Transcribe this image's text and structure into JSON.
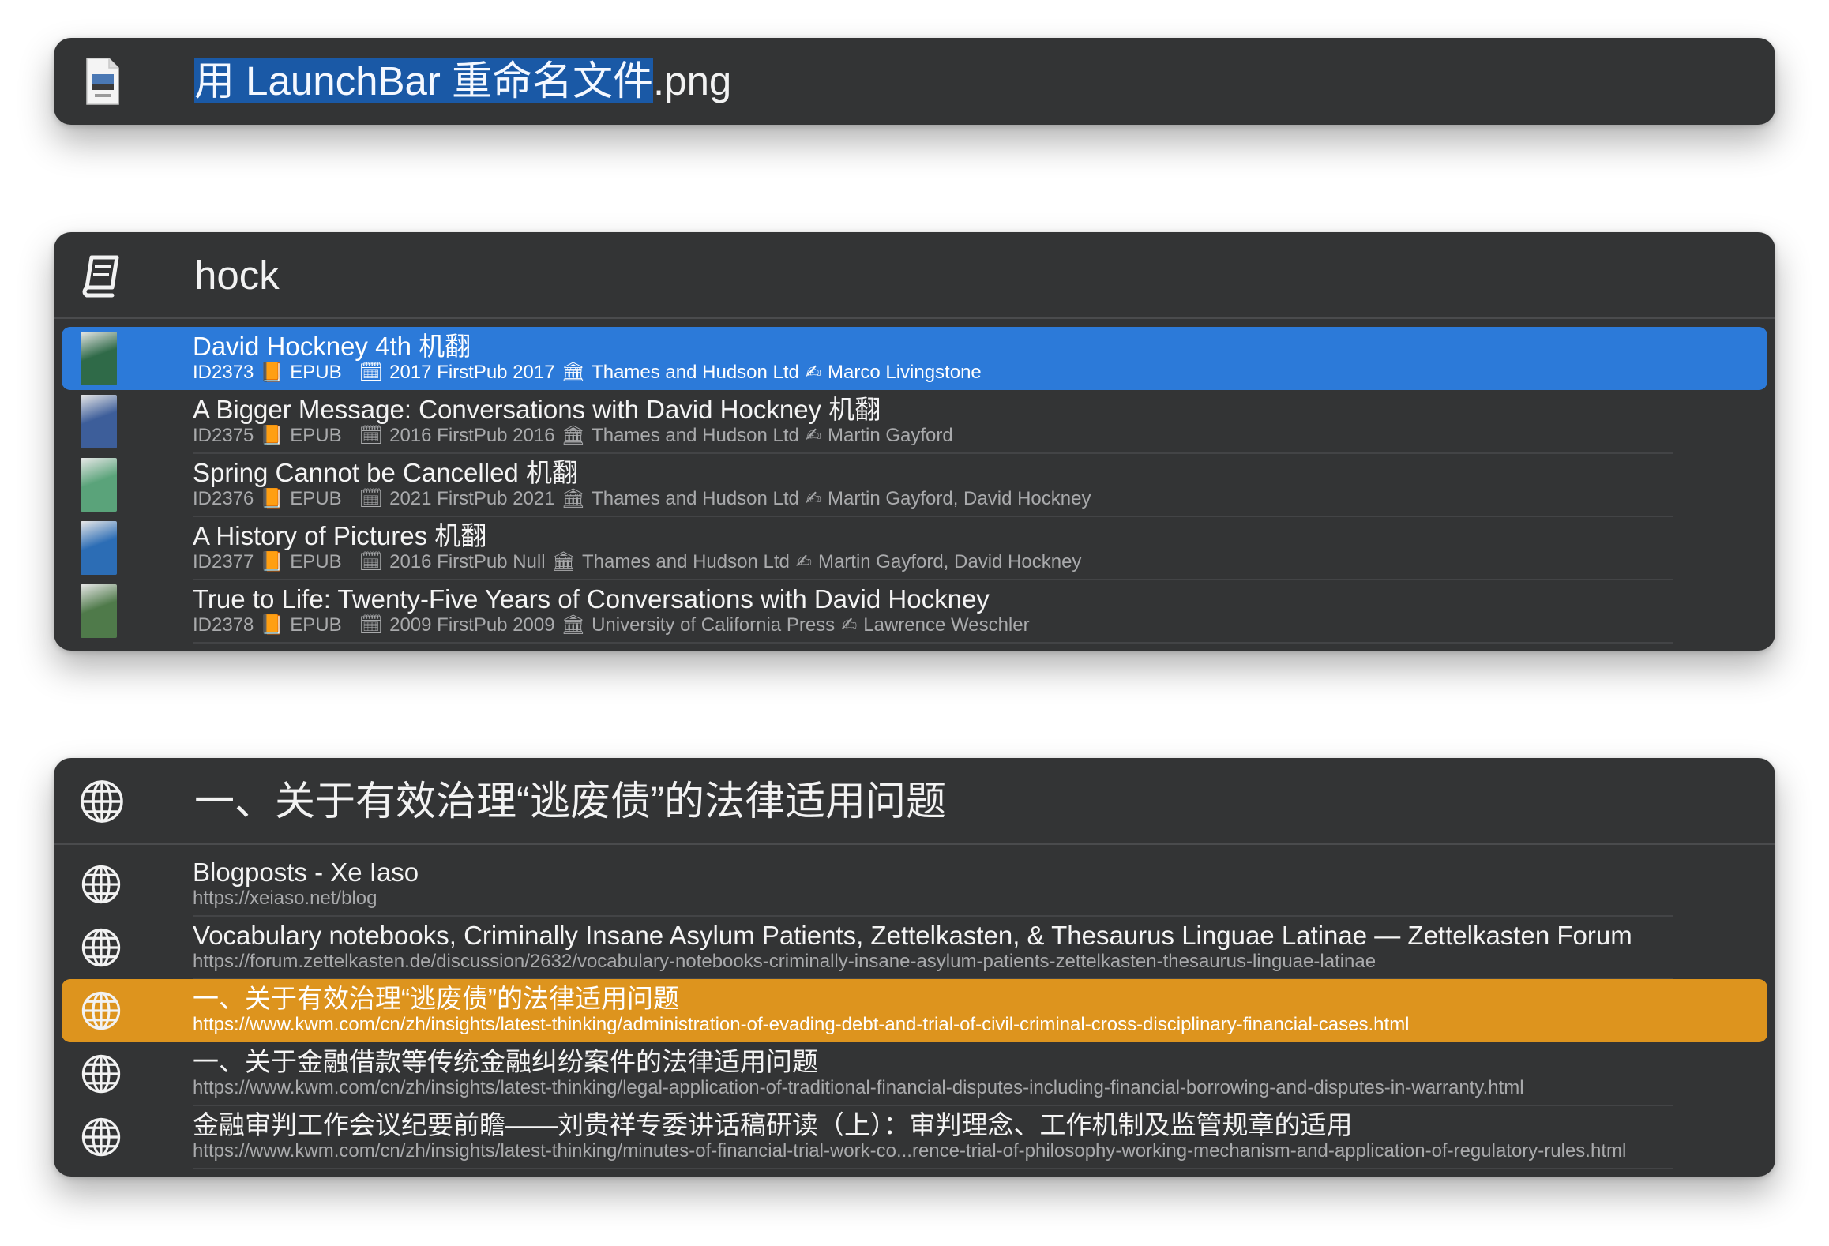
{
  "panel_rename": {
    "icon": "png-file-icon",
    "filename_selected": "用 LaunchBar 重命名文件",
    "filename_ext": ".png"
  },
  "panel_books": {
    "icon": "book-icon",
    "query": "hock",
    "results": [
      {
        "title": "David Hockney 4th 机翻",
        "id": "ID2373",
        "book_glyph": "📙",
        "format": "EPUB",
        "calendar_glyph": "🗓",
        "date": "2017 FirstPub 2017",
        "publisher_glyph": "🏛",
        "publisher": "Thames and Hudson Ltd",
        "author_glyph": "✍",
        "author": "Marco Livingstone",
        "cover_color": "#2f6a48",
        "selected": true
      },
      {
        "title": "A Bigger Message: Conversations with David Hockney 机翻",
        "id": "ID2375",
        "book_glyph": "📙",
        "format": "EPUB",
        "calendar_glyph": "🗓",
        "date": "2016 FirstPub 2016",
        "publisher_glyph": "🏛",
        "publisher": "Thames and Hudson Ltd",
        "author_glyph": "✍",
        "author": "Martin Gayford",
        "cover_color": "#3d5e9a",
        "selected": false
      },
      {
        "title": "Spring Cannot be Cancelled 机翻",
        "id": "ID2376",
        "book_glyph": "📙",
        "format": "EPUB",
        "calendar_glyph": "🗓",
        "date": "2021 FirstPub 2021",
        "publisher_glyph": "🏛",
        "publisher": "Thames and Hudson Ltd",
        "author_glyph": "✍",
        "author": "Martin Gayford, David Hockney",
        "cover_color": "#5aa37a",
        "selected": false
      },
      {
        "title": "A History of Pictures 机翻",
        "id": "ID2377",
        "book_glyph": "📙",
        "format": "EPUB",
        "calendar_glyph": "🗓",
        "date": "2016 FirstPub Null",
        "publisher_glyph": "🏛",
        "publisher": "Thames and Hudson Ltd",
        "author_glyph": "✍",
        "author": "Martin Gayford, David Hockney",
        "cover_color": "#2c6db5",
        "selected": false
      },
      {
        "title": "True to Life: Twenty-Five Years of Conversations with David Hockney",
        "id": "ID2378",
        "book_glyph": "📙",
        "format": "EPUB",
        "calendar_glyph": "🗓",
        "date": "2009 FirstPub 2009",
        "publisher_glyph": "🏛",
        "publisher": "University of California Press",
        "author_glyph": "✍",
        "author": "Lawrence Weschler",
        "cover_color": "#4f7a4a",
        "selected": false
      }
    ]
  },
  "panel_web": {
    "icon": "globe-icon",
    "query": "一、关于有效治理“逃废债”的法律适用问题",
    "results": [
      {
        "title": "Blogposts - Xe Iaso",
        "url": "https://xeiaso.net/blog",
        "selected": false
      },
      {
        "title": "Vocabulary notebooks, Criminally Insane Asylum Patients, Zettelkasten, & Thesaurus Linguae Latinae — Zettelkasten Forum",
        "url": "https://forum.zettelkasten.de/discussion/2632/vocabulary-notebooks-criminally-insane-asylum-patients-zettelkasten-thesaurus-linguae-latinae",
        "selected": false
      },
      {
        "title": "一、关于有效治理“逃废债”的法律适用问题",
        "url": "https://www.kwm.com/cn/zh/insights/latest-thinking/administration-of-evading-debt-and-trial-of-civil-criminal-cross-disciplinary-financial-cases.html",
        "selected": true
      },
      {
        "title": "一、关于金融借款等传统金融纠纷案件的法律适用问题",
        "url": "https://www.kwm.com/cn/zh/insights/latest-thinking/legal-application-of-traditional-financial-disputes-including-financial-borrowing-and-disputes-in-warranty.html",
        "selected": false
      },
      {
        "title": "金融审判工作会议纪要前瞻——刘贵祥专委讲话稿研读（上）：审判理念、工作机制及监管规章的适用",
        "url": "https://www.kwm.com/cn/zh/insights/latest-thinking/minutes-of-financial-trial-work-co...rence-trial-of-philosophy-working-mechanism-and-application-of-regulatory-rules.html",
        "selected": false
      }
    ]
  }
}
